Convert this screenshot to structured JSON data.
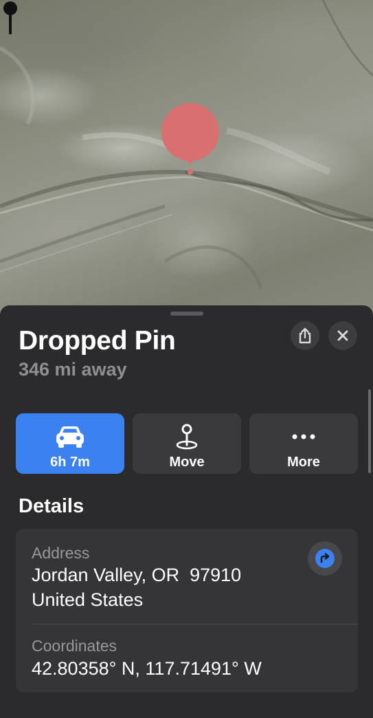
{
  "map": {
    "pin_color": "#d97070",
    "pin_icon": "pushpin-icon"
  },
  "sheet": {
    "title": "Dropped Pin",
    "subtitle": "346 mi away",
    "share_icon": "share-icon",
    "close_icon": "close-icon",
    "actions": [
      {
        "label": "6h 7m",
        "icon": "car-icon",
        "color": "#3b82f0"
      },
      {
        "label": "Move",
        "icon": "pin-move-icon"
      },
      {
        "label": "More",
        "icon": "ellipsis-icon"
      }
    ],
    "details": {
      "heading": "Details",
      "address_label": "Address",
      "address_line1": "Jordan Valley, OR  97910",
      "address_line2": "United States",
      "directions_icon": "directions-arrow-icon",
      "coordinates_label": "Coordinates",
      "coordinates_value": "42.80358° N, 117.71491° W"
    }
  }
}
